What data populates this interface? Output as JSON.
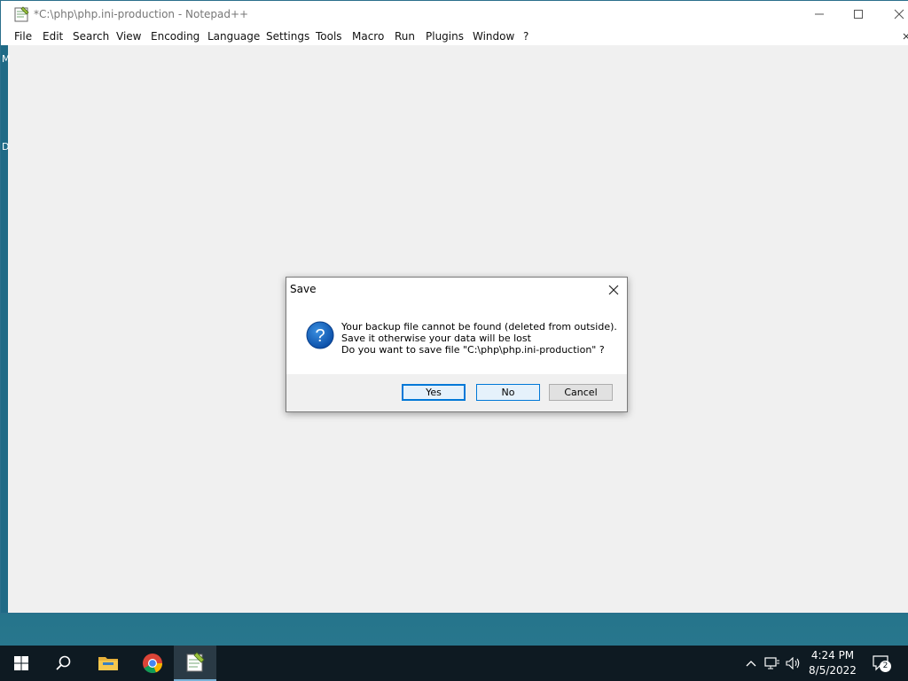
{
  "window": {
    "title": "*C:\\php\\php.ini-production - Notepad++",
    "menu": [
      "File",
      "Edit",
      "Search",
      "View",
      "Encoding",
      "Language",
      "Settings",
      "Tools",
      "Macro",
      "Run",
      "Plugins",
      "Window",
      "?"
    ]
  },
  "dialog": {
    "title": "Save",
    "message_line1": "Your backup file cannot be found (deleted from outside).",
    "message_line2": "Save it otherwise your data will be lost",
    "message_line3": "Do you want to save file \"C:\\php\\php.ini-production\" ?",
    "buttons": {
      "yes": "Yes",
      "no": "No",
      "cancel": "Cancel"
    },
    "icon": "question-icon"
  },
  "taskbar": {
    "time": "4:24 PM",
    "date": "8/5/2022",
    "notification_count": "2",
    "pinned": [
      "windows-start-icon",
      "search-icon",
      "file-explorer-icon",
      "chrome-icon",
      "notepad-plus-plus-icon"
    ]
  },
  "desktop_stray_letters": [
    "M",
    "D"
  ],
  "colors": {
    "accent": "#0078d7",
    "taskbar": "#0e1a22",
    "desktop": "#1f6a86"
  }
}
